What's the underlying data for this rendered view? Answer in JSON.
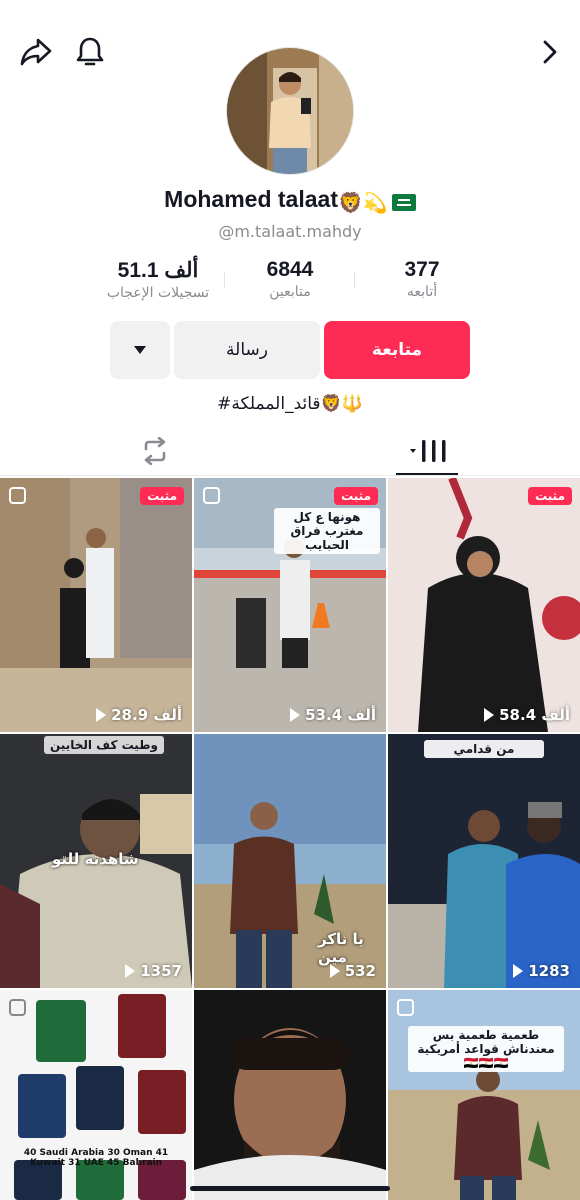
{
  "profile": {
    "name": "Mohamed talaat",
    "name_emojis": "🦁💫",
    "username": "@m.talaat.mahdy",
    "bio": "#قائد_المملكة🦁🔱"
  },
  "stats": {
    "following_count": "377",
    "following_label": "أتابعه",
    "followers_count": "6844",
    "followers_label": "متابعين",
    "likes_count": "51.1 ألف",
    "likes_label": "تسجيلات الإعجاب"
  },
  "buttons": {
    "follow": "متابعة",
    "message": "رسالة"
  },
  "pinned_label": "مثبت",
  "videos": [
    {
      "views": "28.9 ألف",
      "pinned": true
    },
    {
      "views": "53.4 ألف",
      "pinned": true,
      "caption": "هونها ع كل مغترب فراق الحبايب"
    },
    {
      "views": "58.4 ألف",
      "pinned": true
    },
    {
      "views": "1357",
      "overlay": "شاهدته للتو",
      "caption": "وطيت كف الخايين"
    },
    {
      "views": "532",
      "overlay": "يا ناكر مين"
    },
    {
      "views": "1283",
      "caption": "من قدامي"
    },
    {
      "views": "",
      "caption": "40 Saudi Arabia 30 Oman 41 Kuwait 31 UAE 45 Bahrain"
    },
    {
      "views": ""
    },
    {
      "views": "",
      "caption": "طعمية طعمية بس معندناش قواعد أمريكية 🇪🇬🇪🇬🇪🇬"
    }
  ],
  "colors": {
    "accent": "#fe2c55",
    "text": "#161823",
    "muted": "#8a8b91"
  }
}
